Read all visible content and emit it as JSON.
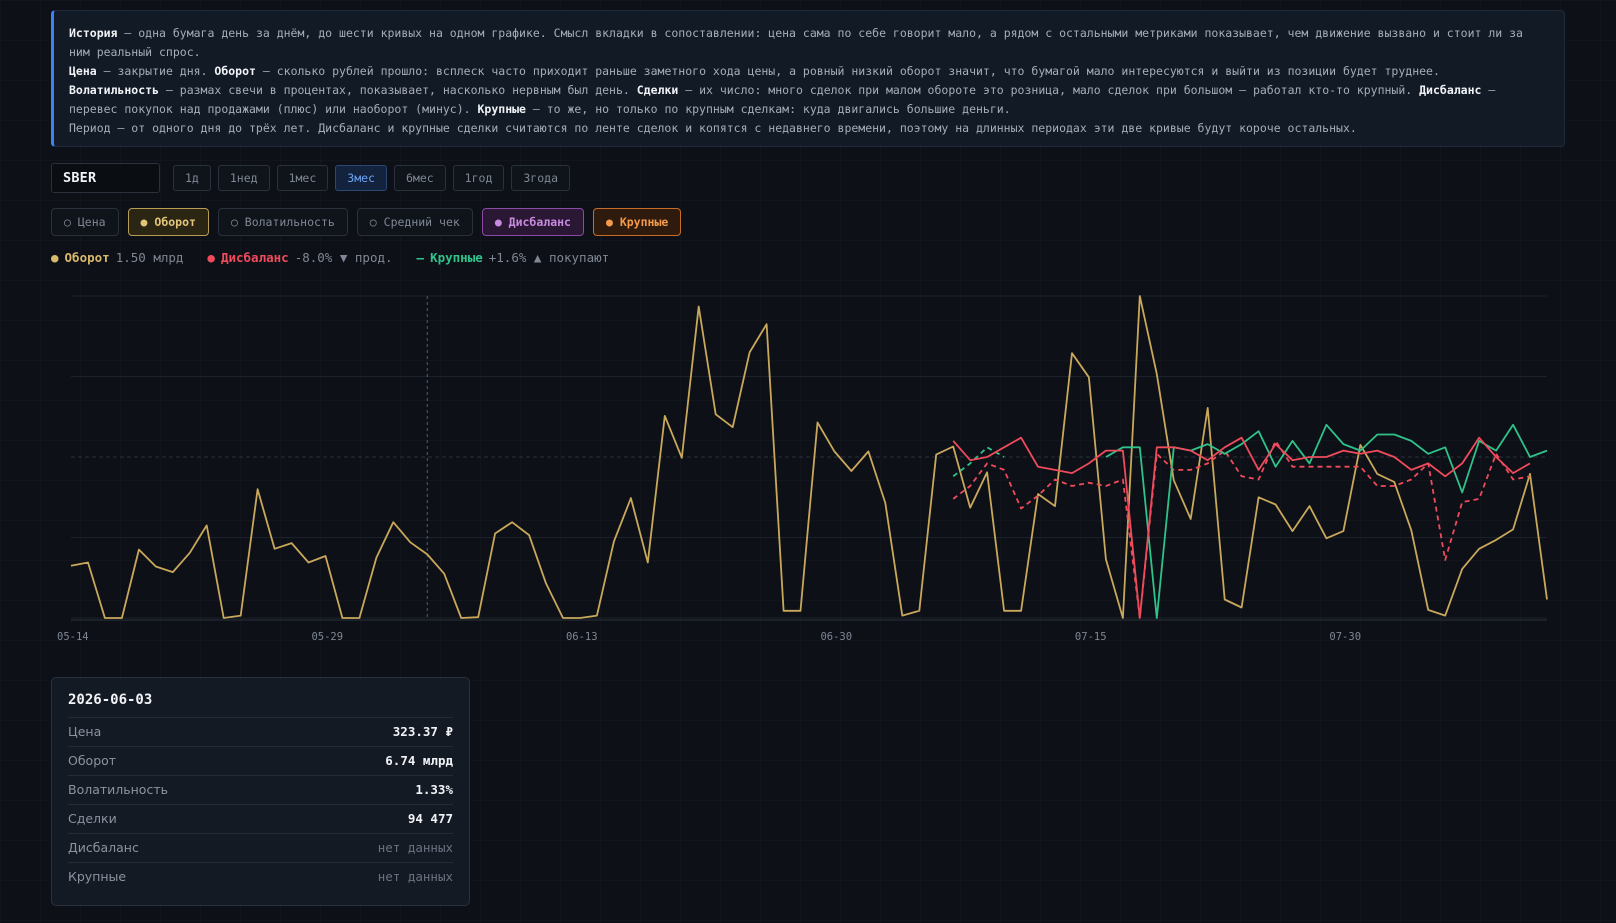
{
  "info": {
    "lines": [
      [
        {
          "b": "История"
        },
        {
          "t": " — одна бумага день за днём, до шести кривых на одном графике. Смысл вкладки в сопоставлении: цена сама по себе говорит мало, а рядом с остальными метриками показывает, чем движение вызвано и стоит ли за ним реальный спрос."
        }
      ],
      [
        {
          "b": "Цена"
        },
        {
          "t": " — закрытие дня. "
        },
        {
          "b": "Оборот"
        },
        {
          "t": " — сколько рублей прошло: всплеск часто приходит раньше заметного хода цены, а ровный низкий оборот значит, что бумагой мало интересуются и выйти из позиции будет труднее."
        }
      ],
      [
        {
          "b": "Волатильность"
        },
        {
          "t": " — размах свечи в процентах, показывает, насколько нервным был день. "
        },
        {
          "b": "Сделки"
        },
        {
          "t": " — их число: много сделок при малом обороте это розница, мало сделок при большом — работал кто-то крупный. "
        },
        {
          "b": "Дисбаланс"
        },
        {
          "t": " — перевес покупок над продажами (плюс) или наоборот (минус). "
        },
        {
          "b": "Крупные"
        },
        {
          "t": " — то же, но только по крупным сделкам: куда двигались большие деньги."
        }
      ],
      [
        {
          "t": "Период — от одного дня до трёх лет. Дисбаланс и крупные сделки считаются по ленте сделок и копятся с недавнего времени, поэтому на длинных периодах эти две кривые будут короче остальных."
        }
      ]
    ]
  },
  "ticker": "SBER",
  "periods": [
    "1д",
    "1нед",
    "1мес",
    "3мес",
    "6мес",
    "1год",
    "3года"
  ],
  "active_period": "3мес",
  "metrics": [
    {
      "label": "○ Цена",
      "state": "off"
    },
    {
      "label": "● Оборот",
      "state": "turnover"
    },
    {
      "label": "○ Волатильность",
      "state": "off"
    },
    {
      "label": "○ Средний чек",
      "state": "off"
    },
    {
      "label": "● Дисбаланс",
      "state": "imbalance"
    },
    {
      "label": "● Крупные",
      "state": "large"
    }
  ],
  "legend": [
    {
      "marker": "●",
      "name": "Оборот",
      "value": "1.50 млрд",
      "color": "#d9b96a"
    },
    {
      "marker": "●",
      "name": "Дисбаланс",
      "value": "-8.0% ▼ прод.",
      "color": "#ef4b5c"
    },
    {
      "marker": "—",
      "name": "Крупные",
      "value": "+1.6% ▲ покупают",
      "color": "#2fc28a"
    }
  ],
  "chart_data": {
    "type": "line",
    "x_ticks": [
      "05-14",
      "05-29",
      "06-13",
      "06-30",
      "07-15",
      "07-30"
    ],
    "hover_x": 21,
    "series": [
      {
        "name": "Оборот",
        "color": "#c9a85c",
        "style": "solid",
        "start": 0,
        "values": [
          0.1625,
          0.1725,
          0.0,
          0.0,
          0.2125,
          0.16,
          0.1425,
          0.2025,
          0.2875,
          0.0,
          0.0075,
          0.4,
          0.215,
          0.2325,
          0.1725,
          0.1925,
          0.0,
          0.0,
          0.1875,
          0.2975,
          0.235,
          0.1975,
          0.1375,
          0.0,
          0.0025,
          0.2625,
          0.2975,
          0.2575,
          0.1075,
          0.0,
          0.0,
          0.0075,
          0.2375,
          0.3725,
          0.1725,
          0.6275,
          0.4975,
          0.9675,
          0.6325,
          0.5925,
          0.825,
          0.9125,
          0.0225,
          0.0225,
          0.6075,
          0.5175,
          0.4565,
          0.5175,
          0.3575,
          0.0075,
          0.0225,
          0.5075,
          0.5325,
          0.3425,
          0.4525,
          0.0225,
          0.0225,
          0.385,
          0.3475,
          0.8225,
          0.7475,
          0.1825,
          0.0,
          1.0,
          0.7575,
          0.4275,
          0.3075,
          0.6525,
          0.0575,
          0.0325,
          0.375,
          0.3525,
          0.27,
          0.3475,
          0.2475,
          0.27,
          0.5375,
          0.4475,
          0.4225,
          0.2725,
          0.025,
          0.0075,
          0.1525,
          0.215,
          0.2425,
          0.275,
          0.4475,
          0.0575
        ]
      },
      {
        "name": "Дисбаланс",
        "color": "#ef4b5c",
        "style": "solid",
        "start": 52,
        "values": [
          0.55,
          0.49,
          0.5,
          0.53,
          0.56,
          0.47,
          0.46,
          0.45,
          0.48,
          0.52,
          0.52,
          0.0,
          0.53,
          0.53,
          0.52,
          0.49,
          0.53,
          0.56,
          0.46,
          0.54,
          0.49,
          0.5,
          0.5,
          0.52,
          0.51,
          0.52,
          0.5,
          0.46,
          0.48,
          0.44,
          0.48,
          0.56,
          0.5,
          0.45,
          0.48
        ]
      },
      {
        "name": "Крупные",
        "color": "#2fc28a",
        "style": "solid",
        "start": 61,
        "values": [
          0.5,
          0.53,
          0.53,
          0.0,
          0.53,
          0.52,
          0.54,
          0.51,
          0.54,
          0.58,
          0.47,
          0.55,
          0.48,
          0.6,
          0.54,
          0.52,
          0.57,
          0.57,
          0.55,
          0.51,
          0.53,
          0.39,
          0.55,
          0.52,
          0.6,
          0.5,
          0.52
        ]
      },
      {
        "name": "Крупные (пунктир)",
        "color": "#2fc28a",
        "style": "dashed",
        "start": 52,
        "values": [
          0.44,
          0.48,
          0.53,
          0.5
        ]
      },
      {
        "name": "Дисбаланс (пунктир)",
        "color": "#ef4b5c",
        "style": "dashed",
        "start": 52,
        "values": [
          0.37,
          0.41,
          0.48,
          0.46,
          0.34,
          0.38,
          0.43,
          0.41,
          0.42,
          0.41,
          0.43,
          0.0,
          0.51,
          0.46,
          0.46,
          0.48,
          0.52,
          0.44,
          0.43,
          0.55,
          0.47,
          0.47,
          0.47,
          0.47,
          0.47,
          0.41,
          0.41,
          0.43,
          0.48,
          0.18,
          0.36,
          0.37,
          0.51,
          0.43,
          0.44
        ]
      }
    ]
  },
  "tooltip": {
    "date": "2026-06-03",
    "rows": [
      {
        "k": "Цена",
        "v": "323.37 ₽"
      },
      {
        "k": "Оборот",
        "v": "6.74 млрд"
      },
      {
        "k": "Волатильность",
        "v": "1.33%"
      },
      {
        "k": "Сделки",
        "v": "94 477"
      },
      {
        "k": "Дисбаланс",
        "v": "нет данных",
        "muted": true
      },
      {
        "k": "Крупные",
        "v": "нет данных",
        "muted": true
      }
    ]
  }
}
